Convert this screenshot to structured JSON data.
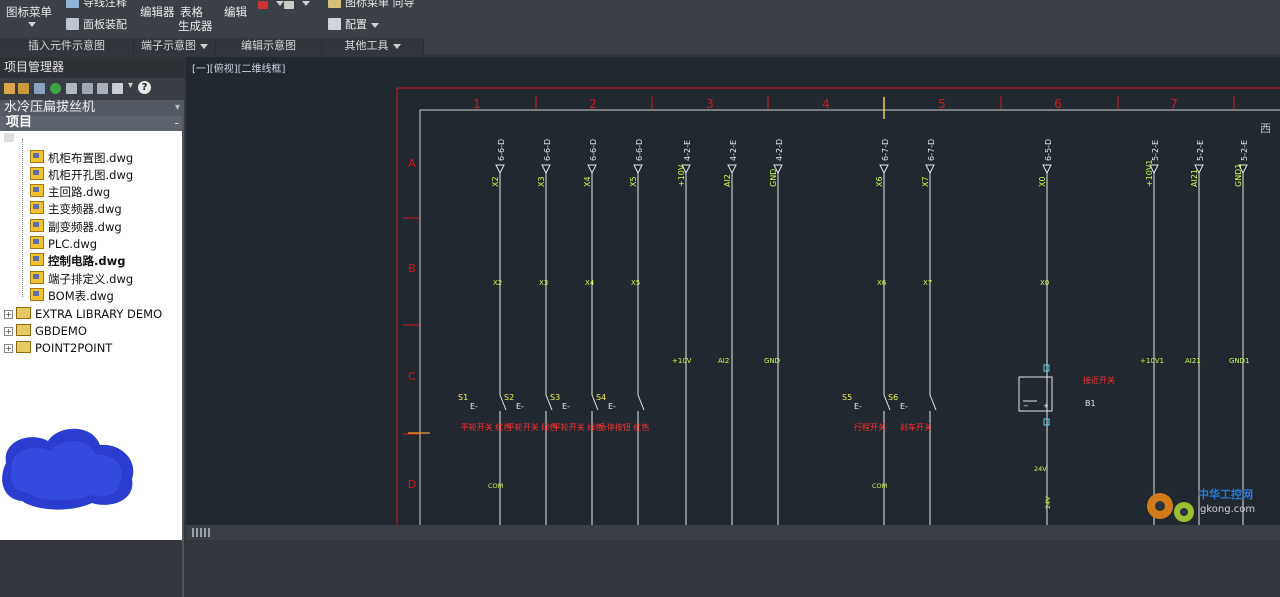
{
  "ribbon": {
    "panels": [
      {
        "title": "插入元件示意图",
        "buttons": [
          {
            "label": "图标菜单"
          },
          {
            "label": "导线注释"
          },
          {
            "label": "面板装配"
          }
        ]
      },
      {
        "title": "端子示意图",
        "buttons": [
          {
            "label": "编辑器"
          },
          {
            "label": "表格"
          },
          {
            "label": "生成器"
          }
        ]
      },
      {
        "title": "编辑示意图",
        "buttons": [
          {
            "label": "编辑"
          }
        ]
      },
      {
        "title": "其他工具",
        "buttons": [
          {
            "label": "图标菜单 向导"
          },
          {
            "label": "配置"
          }
        ]
      }
    ]
  },
  "project_manager": {
    "title": "项目管理器",
    "project_select": "水冷压扁拔丝机",
    "section": "项目",
    "files": [
      {
        "name": "机柜布置图.dwg",
        "bold": false
      },
      {
        "name": "机柜开孔图.dwg",
        "bold": false
      },
      {
        "name": "主回路.dwg",
        "bold": false
      },
      {
        "name": "主变频器.dwg",
        "bold": false
      },
      {
        "name": "副变频器.dwg",
        "bold": false
      },
      {
        "name": "PLC.dwg",
        "bold": false
      },
      {
        "name": "控制电路.dwg",
        "bold": true
      },
      {
        "name": "端子排定义.dwg",
        "bold": false
      },
      {
        "name": "BOM表.dwg",
        "bold": false
      }
    ],
    "projects": [
      "EXTRA LIBRARY DEMO",
      "GBDEMO",
      "POINT2POINT"
    ]
  },
  "viewport": {
    "label": "[一][俯视][二维线框]"
  },
  "drawing": {
    "columns": [
      "1",
      "2",
      "3",
      "4",
      "5",
      "6",
      "7"
    ],
    "rows": [
      "A",
      "B",
      "C",
      "D"
    ],
    "wires": [
      {
        "ref": "6-6-D",
        "tag": "X2",
        "midtag": "X2"
      },
      {
        "ref": "6-6-D",
        "tag": "X3",
        "midtag": "X3"
      },
      {
        "ref": "6-6-D",
        "tag": "X4",
        "midtag": "X4"
      },
      {
        "ref": "6-6-D",
        "tag": "X5",
        "midtag": "X5"
      },
      {
        "ref": "4-2-E",
        "tag": "+10V",
        "lowtag": "+10V"
      },
      {
        "ref": "4-2-E",
        "tag": "AI2",
        "lowtag": "AI2"
      },
      {
        "ref": "4-2-D",
        "tag": "GND",
        "lowtag": "GND"
      },
      {
        "ref": "6-7-D",
        "tag": "X6",
        "midtag": "X6"
      },
      {
        "ref": "6-7-D",
        "tag": "X7",
        "midtag": "X7"
      },
      {
        "ref": "6-5-D",
        "tag": "X0",
        "midtag": "X0"
      },
      {
        "ref": "5-2-E",
        "tag": "+10V1",
        "lowtag": "+10V1"
      },
      {
        "ref": "5-2-E",
        "tag": "AI21",
        "lowtag": "AI21"
      },
      {
        "ref": "5-2-E",
        "tag": "GND1",
        "lowtag": "GND1"
      }
    ],
    "switches": [
      {
        "id": "S1",
        "label": "平轮开关 红色"
      },
      {
        "id": "S2",
        "label": "平轮开关 绿色"
      },
      {
        "id": "S3",
        "label": "平轮开关 绿色"
      },
      {
        "id": "S4",
        "label": "急停按钮 红色"
      },
      {
        "id": "S5",
        "label": "行程开关"
      },
      {
        "id": "S6",
        "label": "刹车开关"
      }
    ],
    "proximity": {
      "id": "B1",
      "label": "接近开关",
      "v1": "24V",
      "v2": "24V"
    },
    "com_tag": "COM",
    "right_edge_text": "西"
  },
  "watermark": {
    "title": "中华工控网",
    "url": "gkong.com"
  },
  "colors": {
    "cad_bg": "#212830",
    "wire": "#e6e6e6",
    "frame_red": "#d21a1a",
    "tag_green": "#c8ff4a",
    "label_red": "#ff3030",
    "tag_cyan": "#5fd6e8"
  }
}
